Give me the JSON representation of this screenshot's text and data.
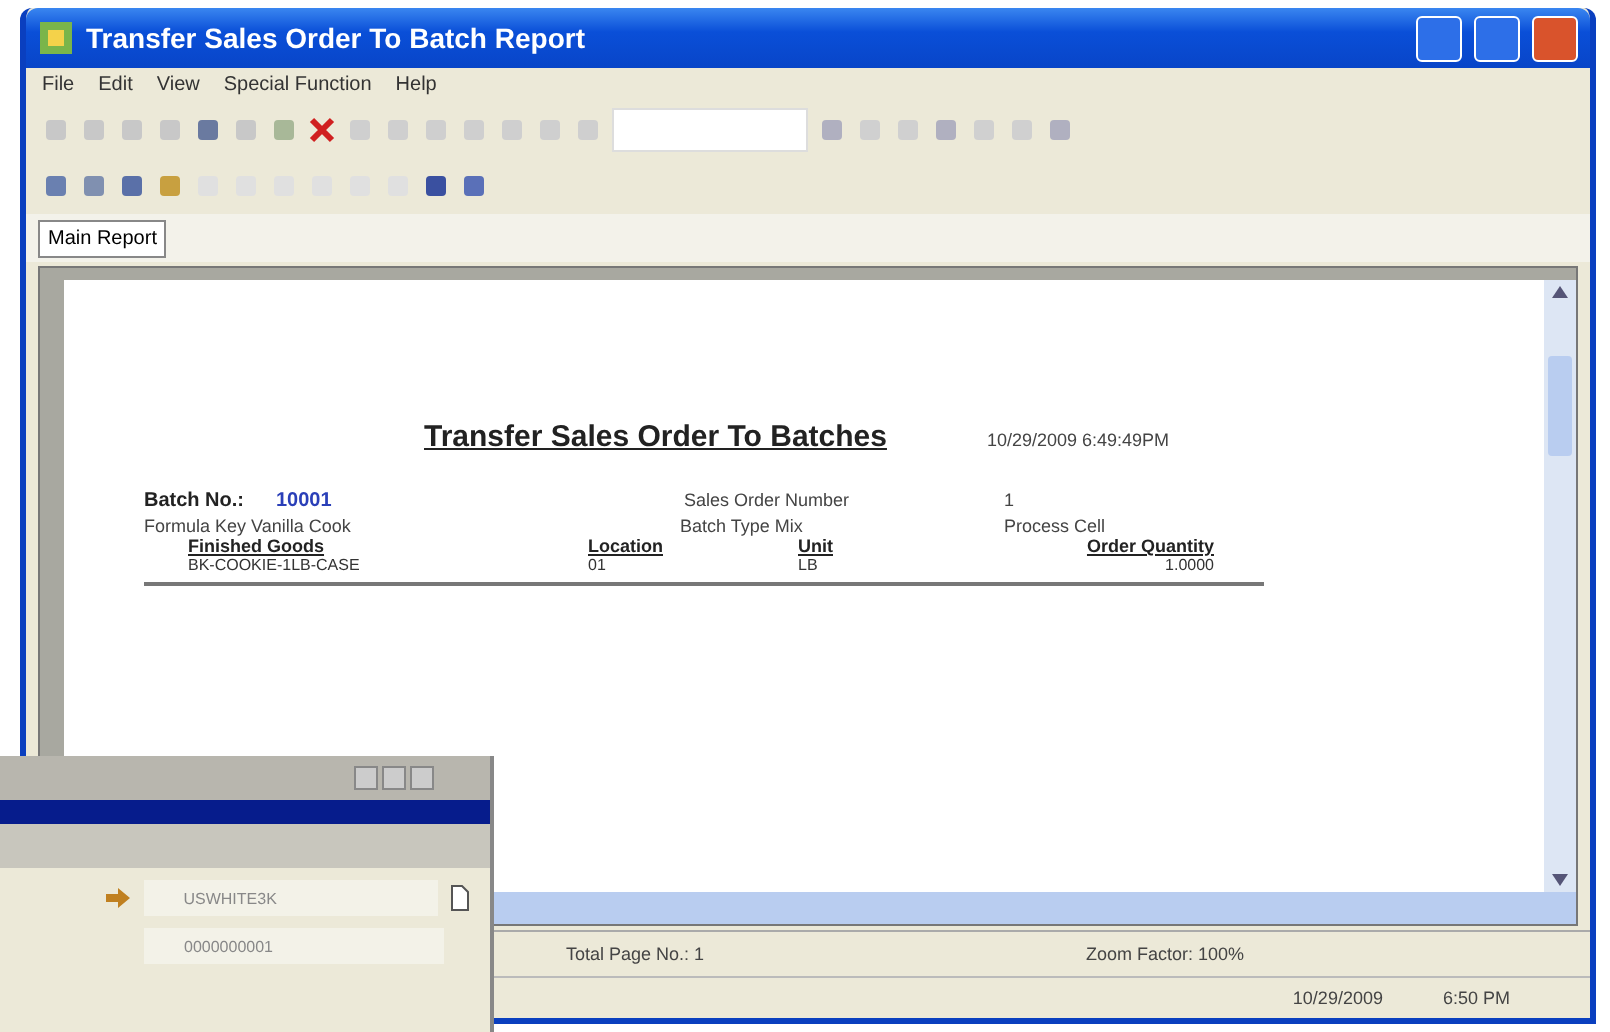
{
  "window": {
    "title": "Transfer Sales Order To Batch Report"
  },
  "menu": [
    "File",
    "Edit",
    "View",
    "Special Function",
    "Help"
  ],
  "tabs": [
    {
      "label": "Main Report",
      "selected": true
    }
  ],
  "report": {
    "title": "Transfer Sales Order To Batches",
    "timestamp": "10/29/2009 6:49:49PM",
    "batch_label": "Batch No.:",
    "batch_value": "10001",
    "sales_order_label": "Sales Order Number",
    "sales_order_value": "1",
    "formula_key": "Formula Key Vanilla Cook",
    "batch_type": "Batch Type Mix",
    "process_cell": "Process Cell",
    "columns": [
      "Finished Goods",
      "Location",
      "Unit",
      "Order Quantity"
    ],
    "rows": [
      [
        "BK-COOKIE-1LB-CASE",
        "01",
        "LB",
        "1.0000"
      ]
    ]
  },
  "status_bar": {
    "pages": "Total Page No.: 1",
    "zoom": "Zoom Factor: 100%"
  },
  "bottom_bar": {
    "date": "10/29/2009",
    "time": "6:50 PM"
  },
  "overlay_window": {
    "field_1": "USWHITE3K",
    "field_2": "0000000001"
  }
}
